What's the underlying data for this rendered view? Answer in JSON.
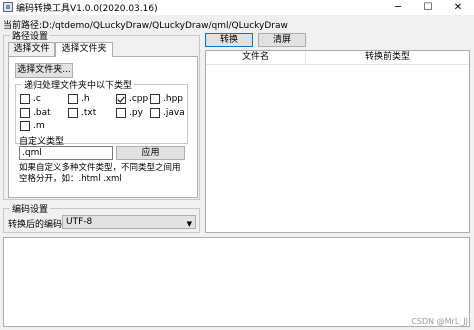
{
  "window": {
    "title": "编码转换工具V1.0.0(2020.03.16)",
    "minimize_glyph": "─",
    "maximize_glyph": "☐",
    "close_glyph": "✕"
  },
  "path": {
    "label": "当前路径:",
    "value": "D:/qtdemo/QLuckyDraw/QLuckyDraw/qml/QLuckyDraw"
  },
  "path_settings": {
    "title": "路径设置",
    "tabs": [
      {
        "label": "选择文件",
        "active": false
      },
      {
        "label": "选择文件夹",
        "active": true
      }
    ],
    "select_folder_button": "选择文件夹...",
    "filetype_group_title": "递归处理文件夹中以下类型",
    "file_types": [
      {
        "label": ".c",
        "checked": false
      },
      {
        "label": ".h",
        "checked": false
      },
      {
        "label": ".cpp",
        "checked": true
      },
      {
        "label": ".hpp",
        "checked": false
      },
      {
        "label": ".bat",
        "checked": false
      },
      {
        "label": ".txt",
        "checked": false
      },
      {
        "label": ".py",
        "checked": false
      },
      {
        "label": ".java",
        "checked": false
      },
      {
        "label": ".m",
        "checked": false
      }
    ],
    "custom_type_label": "自定义类型",
    "custom_type_value": ".qml",
    "apply_button": "应用",
    "hint": "如果自定义多种文件类型，不同类型之间用空格分开，如：.html .xml"
  },
  "toolbar": {
    "convert_label": "转换",
    "clear_label": "清屏"
  },
  "table": {
    "columns": [
      "文件名",
      "转换前类型"
    ]
  },
  "encoding_settings": {
    "title": "编码设置",
    "target_label": "转换后的编码:",
    "target_value": "UTF-8"
  },
  "watermark": "CSDN @MrL_JJ",
  "colors": {
    "background": "#f0f0f0",
    "focus_accent": "#0078d7"
  }
}
